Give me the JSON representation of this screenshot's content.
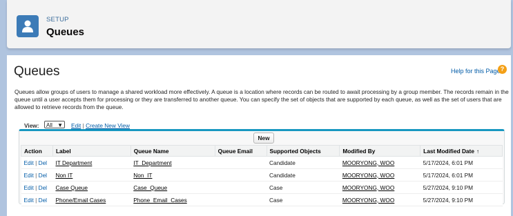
{
  "header": {
    "kicker": "SETUP",
    "title": "Queues"
  },
  "page": {
    "title": "Queues",
    "help_link": "Help for this Page",
    "help_icon": "?",
    "description": "Queues allow groups of users to manage a shared workload more effectively. A queue is a location where records can be routed to await processing by a group member. The records remain in the queue until a user accepts them for processing or they are transferred to another queue. You can specify the set of objects that are supported by each queue, as well as the set of users that are allowed to retrieve records from the queue."
  },
  "view": {
    "label": "View:",
    "selected": "All",
    "edit": "Edit",
    "separator": "|",
    "create": "Create New View"
  },
  "toolbar": {
    "new_label": "New"
  },
  "table": {
    "headers": [
      "Action",
      "Label",
      "Queue Name",
      "Queue Email",
      "Supported Objects",
      "Modified By",
      "Last Modified Date"
    ],
    "sort_indicator": "↑",
    "action_edit": "Edit",
    "action_del": "Del",
    "action_sep": "|",
    "rows": [
      {
        "label": "IT Department",
        "queue_name": "IT_Department",
        "email": "",
        "objects": "Candidate",
        "modified_by": "MOORYONG, WOO",
        "date": "5/17/2024, 6:01 PM"
      },
      {
        "label": "Non IT",
        "queue_name": "Non_IT",
        "email": "",
        "objects": "Candidate",
        "modified_by": "MOORYONG, WOO",
        "date": "5/17/2024, 6:01 PM"
      },
      {
        "label": "Case Queue",
        "queue_name": "Case_Queue",
        "email": "",
        "objects": "Case",
        "modified_by": "MOORYONG, WOO",
        "date": "5/27/2024, 9:10 PM"
      },
      {
        "label": "Phone/Email Cases",
        "queue_name": "Phone_Email_Cases",
        "email": "",
        "objects": "Case",
        "modified_by": "MOORYONG, WOO",
        "date": "5/27/2024, 9:10 PM"
      }
    ]
  },
  "colors": {
    "accent": "#1797c0",
    "link": "#015ba7",
    "icon_bg": "#3c7bb7",
    "help_icon": "#f4a016"
  }
}
